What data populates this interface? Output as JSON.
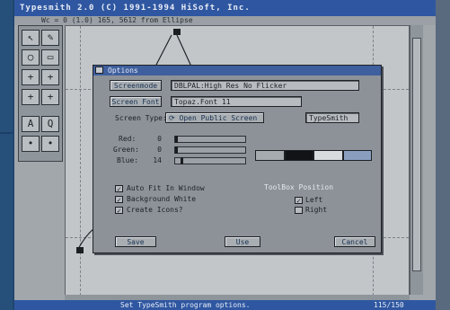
{
  "window": {
    "title": "Typesmith 2.0 (C) 1991-1994 HiSoft, Inc.",
    "info": "Wc = 0 (1.0) 165, 5612 from Ellipse"
  },
  "toolbox": {
    "tools": [
      {
        "icon": "arrow-icon",
        "glyph": "↖"
      },
      {
        "icon": "pencil-icon",
        "glyph": "✎"
      },
      {
        "icon": "ellipse-icon",
        "glyph": "○"
      },
      {
        "icon": "rectangle-icon",
        "glyph": "▭"
      },
      {
        "icon": "node-icon",
        "glyph": "+"
      },
      {
        "icon": "tool-icon",
        "glyph": "+"
      },
      {
        "icon": "tool-icon",
        "glyph": "+"
      },
      {
        "icon": "tool-icon",
        "glyph": "+"
      },
      {
        "icon": "text-icon",
        "glyph": "A"
      },
      {
        "icon": "magnify-icon",
        "glyph": "Q"
      },
      {
        "icon": "point-icon",
        "glyph": "•"
      },
      {
        "icon": "point-icon",
        "glyph": "•"
      }
    ]
  },
  "status": {
    "message": "Set TypeSmith program options.",
    "coords": "115/150"
  },
  "dialog": {
    "title": "Options",
    "screenmode": {
      "label": "Screenmode",
      "value": "DBLPAL:High Res No Flicker"
    },
    "screen_font": {
      "label": "Screen Font",
      "value": "Topaz.Font 11"
    },
    "screen_type": {
      "label": "Screen Type:",
      "value": "Open Public Screen",
      "pubname": "TypeSmith"
    },
    "red": {
      "label": "Red:",
      "value": "0",
      "level": 0.0
    },
    "green": {
      "label": "Green:",
      "value": "0",
      "level": 0.0
    },
    "blue": {
      "label": "Blue:",
      "value": "14",
      "level": 0.08
    },
    "palette_colors": [
      "#a6abb0",
      "#111316",
      "#d8dcdf",
      "#8a9fbf"
    ],
    "checkboxes": [
      {
        "label": "Auto Fit In Window",
        "checked": true
      },
      {
        "label": "Background White",
        "checked": true
      },
      {
        "label": "Create Icons?",
        "checked": true
      }
    ],
    "toolbox_position": {
      "title": "ToolBox Position",
      "options": [
        {
          "label": "Left",
          "checked": true
        },
        {
          "label": "Right",
          "checked": false
        }
      ]
    },
    "buttons": {
      "save": "Save",
      "use": "Use",
      "cancel": "Cancel"
    }
  }
}
